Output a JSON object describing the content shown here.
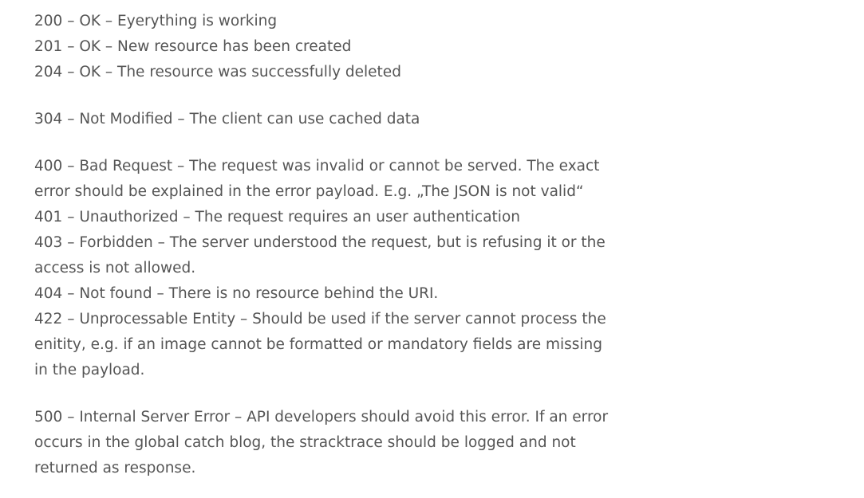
{
  "groups": [
    {
      "lines": [
        "200 – OK – Eyerything is working",
        "201 – OK – New resource has been created",
        "204 – OK – The resource was successfully deleted"
      ]
    },
    {
      "lines": [
        "304 – Not Modified – The client can use cached data"
      ]
    },
    {
      "lines": [
        "400 – Bad Request – The request was invalid or cannot be served. The exact error should be explained in the error payload. E.g. „The JSON is not valid“",
        "401 – Unauthorized – The request requires an user authentication",
        "403 – Forbidden – The server understood the request, but is refusing it or the access is not allowed.",
        "404 – Not found – There is no resource behind the URI.",
        "422 – Unprocessable Entity – Should be used if the server cannot process the enitity, e.g. if an image cannot be formatted or mandatory fields are missing in the payload."
      ]
    },
    {
      "lines": [
        "500 – Internal Server Error – API developers should avoid this error. If an error occurs in the global catch blog, the stracktrace should be logged and not returned as response."
      ]
    }
  ]
}
